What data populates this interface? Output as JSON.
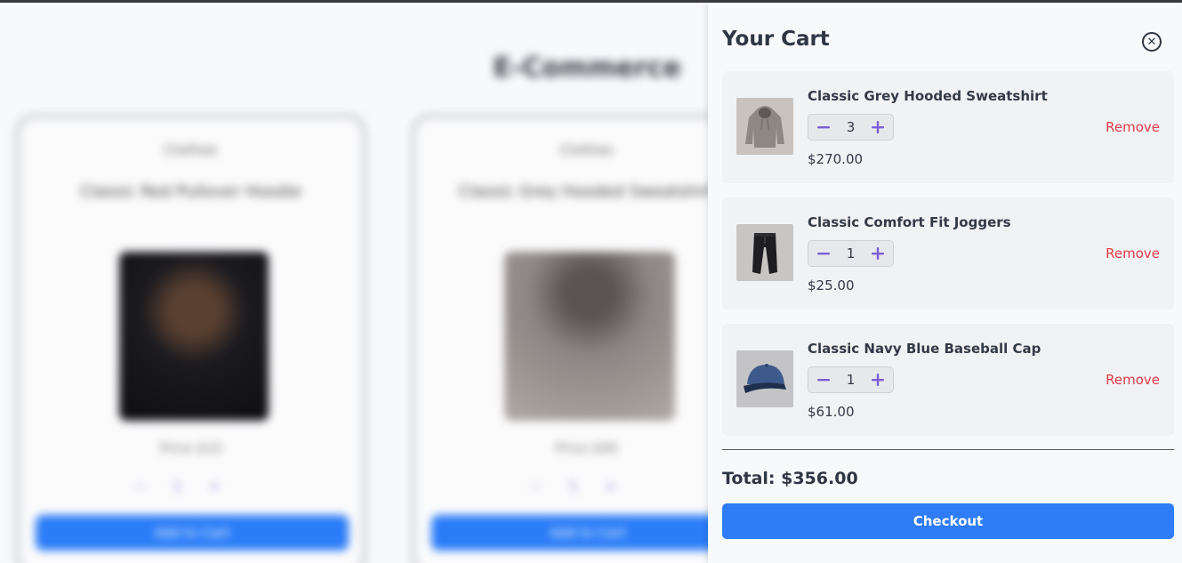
{
  "background": {
    "store_title": "E-Commerce",
    "products": [
      {
        "category": "Clothes",
        "name": "Classic Red Pullover Hoodie",
        "price": "Price $10",
        "qty": "1",
        "add_label": "Add to Cart"
      },
      {
        "category": "Clothes",
        "name": "Classic Grey Hooded Sweatshirt",
        "price": "Price $90",
        "qty": "1",
        "add_label": "Add to Cart"
      }
    ]
  },
  "cart": {
    "title": "Your Cart",
    "close_icon": "close-circle-icon",
    "items": [
      {
        "name": "Classic Grey Hooded Sweatshirt",
        "quantity": "3",
        "price": "$270.00",
        "remove_label": "Remove",
        "image": "grey-hoodie"
      },
      {
        "name": "Classic Comfort Fit Joggers",
        "quantity": "1",
        "price": "$25.00",
        "remove_label": "Remove",
        "image": "black-joggers"
      },
      {
        "name": "Classic Navy Blue Baseball Cap",
        "quantity": "1",
        "price": "$61.00",
        "remove_label": "Remove",
        "image": "navy-cap"
      }
    ],
    "total_label": "Total: $356.00",
    "checkout_label": "Checkout"
  },
  "colors": {
    "accent": "#2e7cf6",
    "stepper_icon": "#7b5fd6",
    "remove": "#e23b4a"
  }
}
